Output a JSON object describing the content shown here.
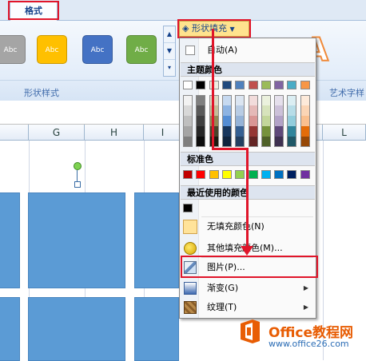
{
  "ribbon": {
    "tab_format": "格式",
    "shape_styles": [
      "Abc",
      "Abc",
      "Abc",
      "Abc"
    ],
    "shape_style_colors": [
      "#a5a5a5",
      "#ffc000",
      "#4472c4",
      "#70ad47"
    ],
    "group_shape_styles": "形状样式",
    "group_wordart": "艺术字样",
    "shape_fill_label": "形状填充",
    "wordart_preview": "A"
  },
  "columns": [
    "G",
    "H",
    "I",
    "L"
  ],
  "menu": {
    "auto": "自动(A)",
    "theme_colors_header": "主题颜色",
    "theme_row": [
      "#ffffff",
      "#000000",
      "#eeece1",
      "#1f497d",
      "#4f81bd",
      "#c0504d",
      "#9bbb59",
      "#8064a2",
      "#4bacc6",
      "#f79646"
    ],
    "theme_shades": [
      [
        "#f2f2f2",
        "#7f7f7f",
        "#ddd9c3",
        "#c6d9f0",
        "#dbe5f1",
        "#f2dcdb",
        "#ebf1dd",
        "#e5e0ec",
        "#dbeef3",
        "#fdeada"
      ],
      [
        "#d8d8d8",
        "#595959",
        "#c4bd97",
        "#8db3e2",
        "#b8cce4",
        "#e5b9b7",
        "#d7e3bc",
        "#ccc1d9",
        "#b7dde8",
        "#fbd5b5"
      ],
      [
        "#bfbfbf",
        "#3f3f3f",
        "#938953",
        "#548dd4",
        "#95b3d7",
        "#d99694",
        "#c3d69b",
        "#b2a2c7",
        "#92cddc",
        "#fac08f"
      ],
      [
        "#a5a5a5",
        "#262626",
        "#494429",
        "#17365d",
        "#366092",
        "#953734",
        "#76923c",
        "#5f497a",
        "#31859b",
        "#e36c09"
      ],
      [
        "#7f7f7f",
        "#0c0c0c",
        "#1d1b10",
        "#0f243e",
        "#244061",
        "#632423",
        "#4f6128",
        "#3f3151",
        "#205867",
        "#974806"
      ]
    ],
    "standard_colors_header": "标准色",
    "standard_colors": [
      "#c00000",
      "#ff0000",
      "#ffc000",
      "#ffff00",
      "#92d050",
      "#00b050",
      "#00b0f0",
      "#0070c0",
      "#002060",
      "#7030a0"
    ],
    "recent_colors_header": "最近使用的颜色",
    "recent_colors": [
      "#000000"
    ],
    "no_fill": "无填充颜色(N)",
    "more_colors": "其他填充颜色(M)...",
    "picture": "图片(P)...",
    "gradient": "渐变(G)",
    "texture": "纹理(T)"
  },
  "watermark": {
    "title": "Office教程网",
    "url": "www.office26.com"
  }
}
